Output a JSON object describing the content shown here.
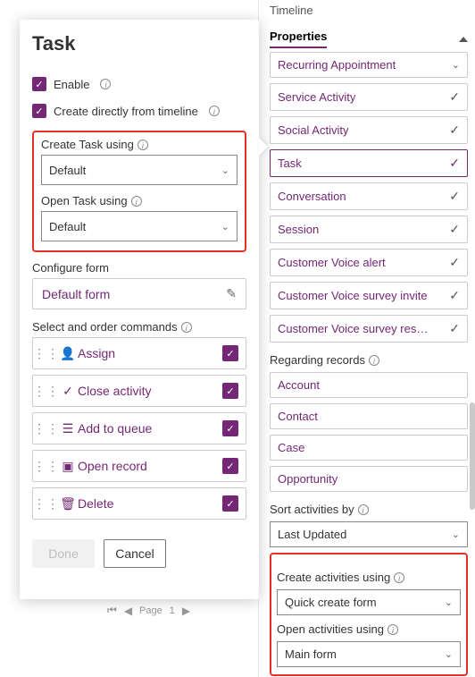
{
  "right_panel": {
    "tabs": {
      "timeline": "Timeline",
      "properties": "Properties"
    },
    "activity_types": [
      {
        "label": "Recurring Appointment",
        "selected": false
      },
      {
        "label": "Service Activity",
        "selected": false
      },
      {
        "label": "Social Activity",
        "selected": false
      },
      {
        "label": "Task",
        "selected": true
      },
      {
        "label": "Conversation",
        "selected": false
      },
      {
        "label": "Session",
        "selected": false
      },
      {
        "label": "Customer Voice alert",
        "selected": false
      },
      {
        "label": "Customer Voice survey invite",
        "selected": false
      },
      {
        "label": "Customer Voice survey response",
        "selected": false
      }
    ],
    "regarding_label": "Regarding records",
    "regarding": [
      {
        "label": "Account"
      },
      {
        "label": "Contact"
      },
      {
        "label": "Case"
      },
      {
        "label": "Opportunity"
      }
    ],
    "sort_label": "Sort activities by",
    "sort_value": "Last Updated",
    "create_label": "Create activities using",
    "create_value": "Quick create form",
    "open_label": "Open activities using",
    "open_value": "Main form"
  },
  "task_panel": {
    "title": "Task",
    "enable_label": "Enable",
    "direct_label": "Create directly from timeline",
    "create_using_label": "Create Task using",
    "create_using_value": "Default",
    "open_using_label": "Open Task using",
    "open_using_value": "Default",
    "configure_form_label": "Configure form",
    "configure_form_value": "Default form",
    "commands_label": "Select and order commands",
    "commands": [
      {
        "icon": "person",
        "label": "Assign"
      },
      {
        "icon": "check",
        "label": "Close activity"
      },
      {
        "icon": "queue",
        "label": "Add to queue"
      },
      {
        "icon": "open",
        "label": "Open record"
      },
      {
        "icon": "trash",
        "label": "Delete"
      }
    ],
    "done": "Done",
    "cancel": "Cancel"
  },
  "pager": {
    "page_label": "Page",
    "page_num": "1"
  }
}
